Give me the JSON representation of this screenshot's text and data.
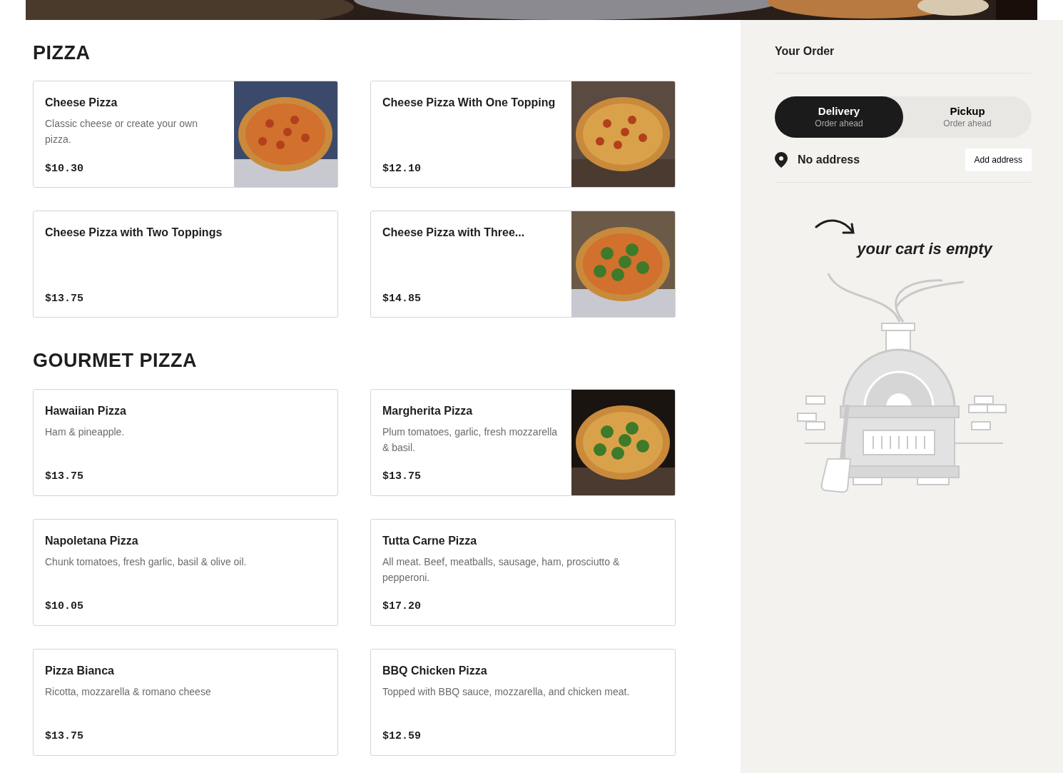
{
  "sections": [
    {
      "title": "PIZZA",
      "items": [
        {
          "name": "Cheese Pizza",
          "description": "Classic cheese or create your own pizza.",
          "price": "$10.30",
          "photo": true
        },
        {
          "name": "Cheese Pizza With One Topping",
          "price": "$12.10",
          "photo": true
        },
        {
          "name": "Cheese Pizza with Two Toppings",
          "price": "$13.75",
          "photo": false
        },
        {
          "name": "Cheese Pizza with Three...",
          "price": "$14.85",
          "photo": true
        }
      ]
    },
    {
      "title": "GOURMET PIZZA",
      "items": [
        {
          "name": "Hawaiian Pizza",
          "description": "Ham & pineapple.",
          "price": "$13.75",
          "photo": false
        },
        {
          "name": "Margherita Pizza",
          "description": "Plum tomatoes, garlic, fresh mozzarella & basil.",
          "price": "$13.75",
          "photo": true
        },
        {
          "name": "Napoletana Pizza",
          "description": "Chunk tomatoes, fresh garlic, basil & olive oil.",
          "price": "$10.05",
          "photo": false
        },
        {
          "name": "Tutta Carne Pizza",
          "description": "All meat. Beef, meatballs, sausage, ham, prosciutto & pepperoni.",
          "price": "$17.20",
          "photo": false
        },
        {
          "name": "Pizza Bianca",
          "description": "Ricotta, mozzarella & romano cheese",
          "price": "$13.75",
          "photo": false
        },
        {
          "name": "BBQ Chicken Pizza",
          "description": "Topped with BBQ sauce, mozzarella, and chicken meat.",
          "price": "$12.59",
          "photo": false
        }
      ]
    }
  ],
  "order": {
    "title": "Your Order",
    "modes": [
      {
        "label": "Delivery",
        "sublabel": "Order ahead",
        "selected": true
      },
      {
        "label": "Pickup",
        "sublabel": "Order ahead",
        "selected": false
      }
    ],
    "address": "No address",
    "address_button": "Add address",
    "empty_message": "your cart is empty"
  }
}
